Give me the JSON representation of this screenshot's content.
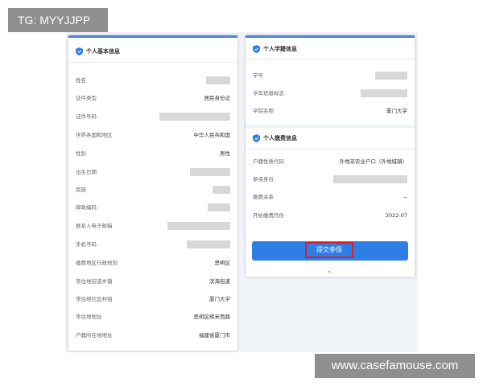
{
  "tag": "TG: MYYJJPP",
  "watermark": "www.casefamouse.com",
  "basic_info": {
    "title": "个人基本信息",
    "rows": [
      {
        "label": "姓名",
        "value": ""
      },
      {
        "label": "证件类型",
        "value": "居民身份证"
      },
      {
        "label": "证件号码",
        "value": ""
      },
      {
        "label": "世界各国和地区",
        "value": "中华人民共和国"
      },
      {
        "label": "性别",
        "value": "男性"
      },
      {
        "label": "出生日期",
        "value": ""
      },
      {
        "label": "民族",
        "value": ""
      },
      {
        "label": "邮政编码",
        "value": ""
      },
      {
        "label": "联系人电子邮箱",
        "value": ""
      },
      {
        "label": "手机号码",
        "value": ""
      },
      {
        "label": "缴费地区行政规划",
        "value": "思明区"
      },
      {
        "label": "常住地街道乡镇",
        "value": "滨海街道"
      },
      {
        "label": "常住地社区村组",
        "value": "厦门大学"
      },
      {
        "label": "常住地地址",
        "value": "思明区辉米西路"
      },
      {
        "label": "户籍所在地地址",
        "value": "福建省厦门市"
      }
    ]
  },
  "school_info": {
    "title": "个人学籍信息",
    "rows": [
      {
        "label": "学号",
        "value": ""
      },
      {
        "label": "学年班级标志",
        "value": ""
      },
      {
        "label": "学院名称",
        "value": "厦门大学"
      }
    ]
  },
  "pay_info": {
    "title": "个人缴费信息",
    "rows": [
      {
        "label": "户籍性质代码",
        "value": "外地非农业户口（外地城镇）"
      },
      {
        "label": "参保身份",
        "value": ""
      },
      {
        "label": "缴费关系",
        "value": "--"
      },
      {
        "label": "开始缴费月份",
        "value": "2022-07"
      }
    ]
  },
  "submit_label": "提交参保",
  "colors": {
    "accent": "#2f7ee6",
    "highlight": "#d8212a",
    "redacted": "#d8d8d8"
  }
}
